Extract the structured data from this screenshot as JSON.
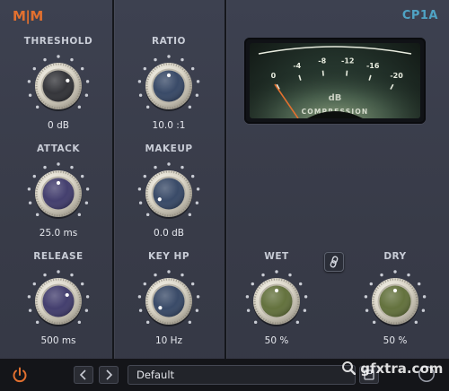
{
  "header": {
    "logo": "M|M",
    "plugin_name": "CP1A"
  },
  "colors": {
    "accent_orange": "#e2702f",
    "brand_blue": "#4fa3c4",
    "meter_needle": "#e2702f"
  },
  "knobs": {
    "threshold": {
      "label": "THRESHOLD",
      "value": "0 dB",
      "cap_color": "#2a2b30",
      "level": 0.72
    },
    "attack": {
      "label": "ATTACK",
      "value": "25.0 ms",
      "cap_color": "#3a3567",
      "level": 0.5
    },
    "release": {
      "label": "RELEASE",
      "value": "500 ms",
      "cap_color": "#3a3567",
      "level": 0.7
    },
    "ratio": {
      "label": "RATIO",
      "value": "10.0 :1",
      "cap_color": "#2f4160",
      "level": 0.5
    },
    "makeup": {
      "label": "MAKEUP",
      "value": "0.0 dB",
      "cap_color": "#2f4160",
      "level": 0.05
    },
    "key_hp": {
      "label": "KEY HP",
      "value": "10 Hz",
      "cap_color": "#2f4160",
      "level": 0.03
    },
    "wet": {
      "label": "WET",
      "value": "50 %",
      "cap_color": "#5c6b34",
      "level": 0.5
    },
    "dry": {
      "label": "DRY",
      "value": "50 %",
      "cap_color": "#5c6b34",
      "level": 0.5
    }
  },
  "meter": {
    "ticks": [
      "0",
      "-4",
      "-8",
      "-12",
      "-16",
      "-20"
    ],
    "unit": "dB",
    "caption": "COMPRESSION",
    "needle_db": 0
  },
  "link_button": {
    "icon": "link-icon"
  },
  "bottom_bar": {
    "power_icon": "power-icon",
    "prev_icon": "chevron-left-icon",
    "next_icon": "chevron-right-icon",
    "preset_name": "Default",
    "watermark": "gfxtra.com"
  }
}
